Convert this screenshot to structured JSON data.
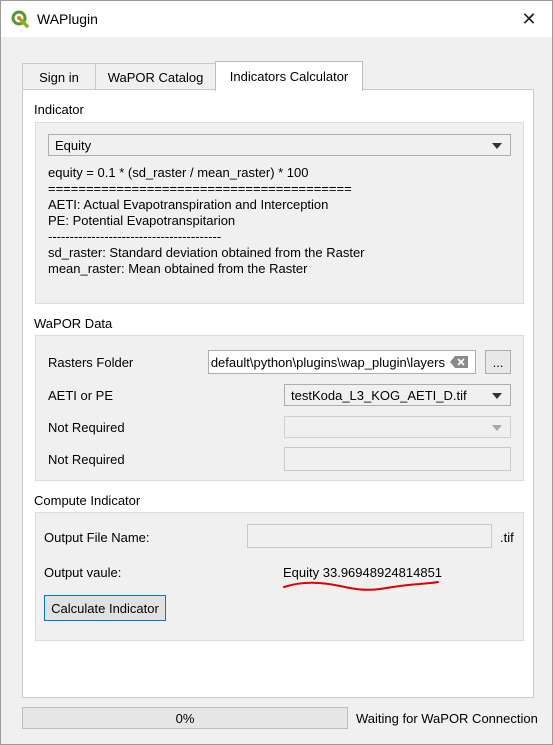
{
  "window": {
    "title": "WAPlugin"
  },
  "tabs": [
    {
      "label": "Sign in"
    },
    {
      "label": "WaPOR Catalog"
    },
    {
      "label": "Indicators Calculator"
    }
  ],
  "indicator": {
    "group_title": "Indicator",
    "selected": "Equity",
    "description_lines": [
      "equity = 0.1 * (sd_raster / mean_raster) * 100",
      "========================================",
      "AETI: Actual Evapotranspiration and Interception",
      "PE: Potential Evapotranspitarion",
      "----------------------------------------",
      "sd_raster: Standard deviation obtained from the Raster",
      "mean_raster: Mean obtained from the Raster"
    ]
  },
  "wapor_data": {
    "group_title": "WaPOR Data",
    "rasters_folder_label": "Rasters Folder",
    "rasters_folder_value": "default\\python\\plugins\\wap_plugin\\layers",
    "browse_label": "...",
    "aeti_label": "AETI or PE",
    "aeti_value": "testKoda_L3_KOG_AETI_D.tif",
    "not_required_1_label": "Not Required",
    "not_required_2_label": "Not Required"
  },
  "compute": {
    "group_title": "Compute Indicator",
    "output_file_label": "Output File Name:",
    "output_file_value": "",
    "tif_suffix": ".tif",
    "output_value_label": "Output vaule:",
    "output_value": "Equity 33.96948924814851",
    "button_label": "Calculate Indicator",
    "annotation_color": "#e00000"
  },
  "footer": {
    "progress": 0,
    "progress_text": "0%",
    "status": "Waiting for WaPOR Connection"
  }
}
